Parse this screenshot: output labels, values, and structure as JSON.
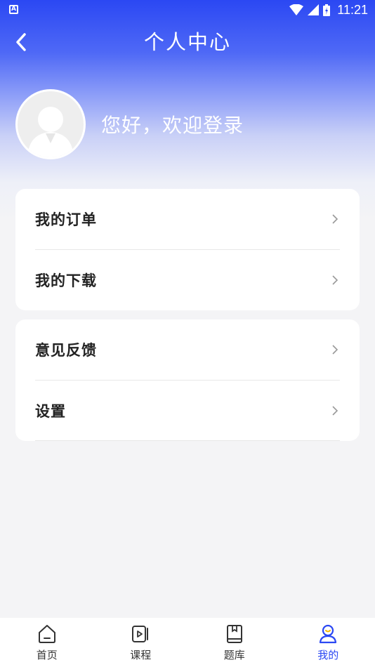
{
  "status_bar": {
    "time": "11:21",
    "notification_icon": "app-notification-icon"
  },
  "header": {
    "title": "个人中心",
    "back_icon": "chevron-left-icon"
  },
  "profile": {
    "greeting": "您好，欢迎登录",
    "avatar_icon": "default-avatar-icon"
  },
  "menu_groups": [
    {
      "items": [
        {
          "label": "我的订单"
        },
        {
          "label": "我的下载"
        }
      ]
    },
    {
      "items": [
        {
          "label": "意见反馈"
        },
        {
          "label": "设置"
        }
      ]
    }
  ],
  "tabs": [
    {
      "label": "首页",
      "icon": "home-icon"
    },
    {
      "label": "课程",
      "icon": "course-video-icon"
    },
    {
      "label": "题库",
      "icon": "question-bank-book-icon"
    },
    {
      "label": "我的",
      "icon": "profile-icon",
      "active": true
    }
  ],
  "colors": {
    "accent": "#2b48f3",
    "background": "#f4f4f6"
  }
}
